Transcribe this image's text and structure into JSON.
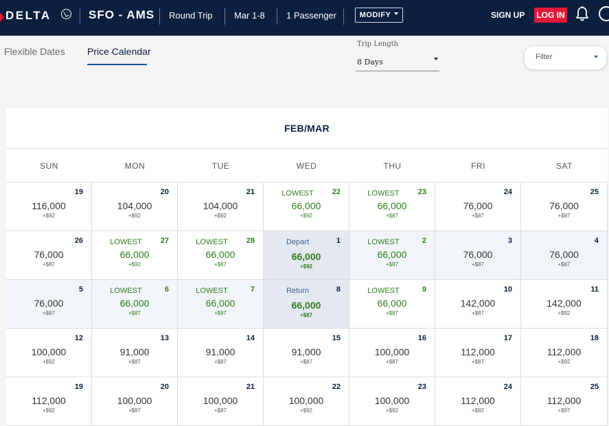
{
  "header": {
    "brand": "DELTA",
    "route": "SFO - AMS",
    "trip_type": "Round Trip",
    "dates": "Mar 1-8",
    "passengers": "1 Passenger",
    "modify_label": "MODIFY",
    "signup_label": "SIGN UP",
    "login_label": "LOG IN",
    "colors": {
      "navy": "#0b1f3f",
      "red": "#e31837",
      "green": "#2e7d1b"
    }
  },
  "tabs": [
    {
      "label": "Flexible Dates",
      "active": false
    },
    {
      "label": "Price Calendar",
      "active": true
    }
  ],
  "trip_length": {
    "label": "Trip Length",
    "value": "8 Days"
  },
  "filter": {
    "label": "Filter"
  },
  "calendar": {
    "month_title": "FEB/MAR",
    "weekdays": [
      "SUN",
      "MON",
      "TUE",
      "WED",
      "THU",
      "FRI",
      "SAT"
    ],
    "weeks": [
      [
        {
          "day": "19",
          "price": "116,000",
          "tax": "+$92",
          "tag": "",
          "state": ""
        },
        {
          "day": "20",
          "price": "104,000",
          "tax": "+$92",
          "tag": "",
          "state": ""
        },
        {
          "day": "21",
          "price": "104,000",
          "tax": "+$92",
          "tag": "",
          "state": ""
        },
        {
          "day": "22",
          "price": "66,000",
          "tax": "+$92",
          "tag": "LOWEST",
          "state": "low"
        },
        {
          "day": "23",
          "price": "66,000",
          "tax": "+$87",
          "tag": "LOWEST",
          "state": "low"
        },
        {
          "day": "24",
          "price": "76,000",
          "tax": "+$87",
          "tag": "",
          "state": ""
        },
        {
          "day": "25",
          "price": "76,000",
          "tax": "+$87",
          "tag": "",
          "state": ""
        }
      ],
      [
        {
          "day": "26",
          "price": "76,000",
          "tax": "+$87",
          "tag": "",
          "state": ""
        },
        {
          "day": "27",
          "price": "66,000",
          "tax": "+$92",
          "tag": "LOWEST",
          "state": "low"
        },
        {
          "day": "28",
          "price": "66,000",
          "tax": "+$87",
          "tag": "LOWEST",
          "state": "low"
        },
        {
          "day": "1",
          "price": "66,000",
          "tax": "+$92",
          "tag": "Depart",
          "state": "sel"
        },
        {
          "day": "2",
          "price": "66,000",
          "tax": "+$87",
          "tag": "LOWEST",
          "state": "low range"
        },
        {
          "day": "3",
          "price": "76,000",
          "tax": "+$87",
          "tag": "",
          "state": "range"
        },
        {
          "day": "4",
          "price": "76,000",
          "tax": "+$87",
          "tag": "",
          "state": "range"
        }
      ],
      [
        {
          "day": "5",
          "price": "76,000",
          "tax": "+$87",
          "tag": "",
          "state": "range"
        },
        {
          "day": "6",
          "price": "66,000",
          "tax": "+$87",
          "tag": "LOWEST",
          "state": "low range"
        },
        {
          "day": "7",
          "price": "66,000",
          "tax": "+$87",
          "tag": "LOWEST",
          "state": "low range"
        },
        {
          "day": "8",
          "price": "66,000",
          "tax": "+$87",
          "tag": "Return",
          "state": "sel"
        },
        {
          "day": "9",
          "price": "66,000",
          "tax": "+$87",
          "tag": "LOWEST",
          "state": "low"
        },
        {
          "day": "10",
          "price": "142,000",
          "tax": "+$87",
          "tag": "",
          "state": ""
        },
        {
          "day": "11",
          "price": "142,000",
          "tax": "+$92",
          "tag": "",
          "state": ""
        }
      ],
      [
        {
          "day": "12",
          "price": "100,000",
          "tax": "+$92",
          "tag": "",
          "state": ""
        },
        {
          "day": "13",
          "price": "91,000",
          "tax": "+$87",
          "tag": "",
          "state": ""
        },
        {
          "day": "14",
          "price": "91,000",
          "tax": "+$87",
          "tag": "",
          "state": ""
        },
        {
          "day": "15",
          "price": "91,000",
          "tax": "+$87",
          "tag": "",
          "state": ""
        },
        {
          "day": "16",
          "price": "100,000",
          "tax": "+$87",
          "tag": "",
          "state": ""
        },
        {
          "day": "17",
          "price": "112,000",
          "tax": "+$87",
          "tag": "",
          "state": ""
        },
        {
          "day": "18",
          "price": "112,000",
          "tax": "+$92",
          "tag": "",
          "state": ""
        }
      ],
      [
        {
          "day": "19",
          "price": "112,000",
          "tax": "+$92",
          "tag": "",
          "state": ""
        },
        {
          "day": "20",
          "price": "100,000",
          "tax": "+$87",
          "tag": "",
          "state": ""
        },
        {
          "day": "21",
          "price": "100,000",
          "tax": "+$87",
          "tag": "",
          "state": ""
        },
        {
          "day": "22",
          "price": "100,000",
          "tax": "+$92",
          "tag": "",
          "state": ""
        },
        {
          "day": "23",
          "price": "100,000",
          "tax": "+$92",
          "tag": "",
          "state": ""
        },
        {
          "day": "24",
          "price": "112,000",
          "tax": "+$92",
          "tag": "",
          "state": ""
        },
        {
          "day": "25",
          "price": "112,000",
          "tax": "+$97",
          "tag": "",
          "state": ""
        }
      ]
    ]
  }
}
